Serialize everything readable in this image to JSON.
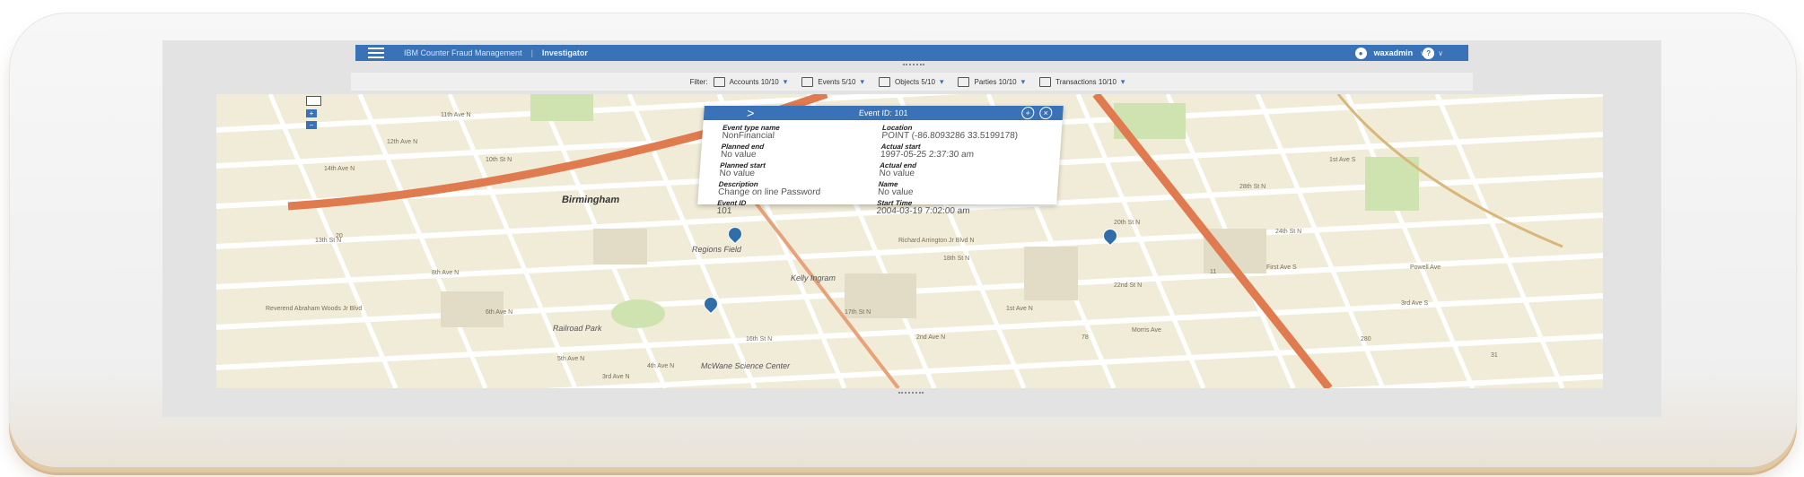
{
  "app": {
    "title": "IBM Counter Fraud Management",
    "separator": "|",
    "context": "Investigator",
    "user": "waxadmin",
    "user_caret": "∨",
    "help_caret": "∨"
  },
  "filter": {
    "label": "Filter:",
    "items": [
      {
        "label": "Accounts 10/10",
        "icon": "accounts-icon"
      },
      {
        "label": "Events 5/10",
        "icon": "events-icon"
      },
      {
        "label": "Objects 5/10",
        "icon": "objects-icon"
      },
      {
        "label": "Parties 10/10",
        "icon": "parties-icon"
      },
      {
        "label": "Transactions 10/10",
        "icon": "transactions-icon"
      }
    ],
    "dropdown_glyph": "▾"
  },
  "map": {
    "places": {
      "birmingham": "Birmingham",
      "regions_field": "Regions Field",
      "railroad_park": "Railroad Park",
      "mcwane": "McWane Science Center",
      "kelly_ingram": "Kelly Ingram"
    },
    "streets": [
      "11th Ave N",
      "12th Ave N",
      "14th Ave N",
      "10th St N",
      "13th St N",
      "8th Ave N",
      "6th Ave N",
      "5th Ave N",
      "4th Ave N",
      "3rd Ave N",
      "2nd Ave N",
      "1st Ave N",
      "22nd St N",
      "24th St N",
      "20th St N",
      "18th St N",
      "17th St N",
      "16th St N",
      "Reverend Abraham Woods Jr Blvd",
      "Richard Arrington Jr Blvd N",
      "Morris Ave",
      "First Ave S",
      "Powell Ave",
      "3rd Ave S",
      "1st Ave S",
      "28th St N"
    ],
    "route_badges": [
      "20",
      "11",
      "78",
      "280",
      "31"
    ]
  },
  "popup": {
    "title": "Event ID: 101",
    "expand_glyph": ">",
    "left": [
      {
        "label": "Event type name",
        "value": "NonFinancial"
      },
      {
        "label": "Planned end",
        "value": "No value"
      },
      {
        "label": "Planned start",
        "value": "No value"
      },
      {
        "label": "Description",
        "value": "Change on line Password"
      },
      {
        "label": "Event ID",
        "value": "101"
      }
    ],
    "right": [
      {
        "label": "Location",
        "value": "POINT (-86.8093286 33.5199178)"
      },
      {
        "label": "Actual start",
        "value": "1997-05-25 2:37:30 am"
      },
      {
        "label": "Actual end",
        "value": "No value"
      },
      {
        "label": "Name",
        "value": "No value"
      },
      {
        "label": "Start Time",
        "value": "2004-03-19 7:02:00 am"
      }
    ],
    "add_glyph": "+",
    "close_glyph": "×"
  },
  "colors": {
    "app_bar": "#3a72b7",
    "map_land": "#f1ecd8",
    "highway": "#e07a4f",
    "park": "#cfe3b0",
    "pin": "#2f6ea8"
  }
}
